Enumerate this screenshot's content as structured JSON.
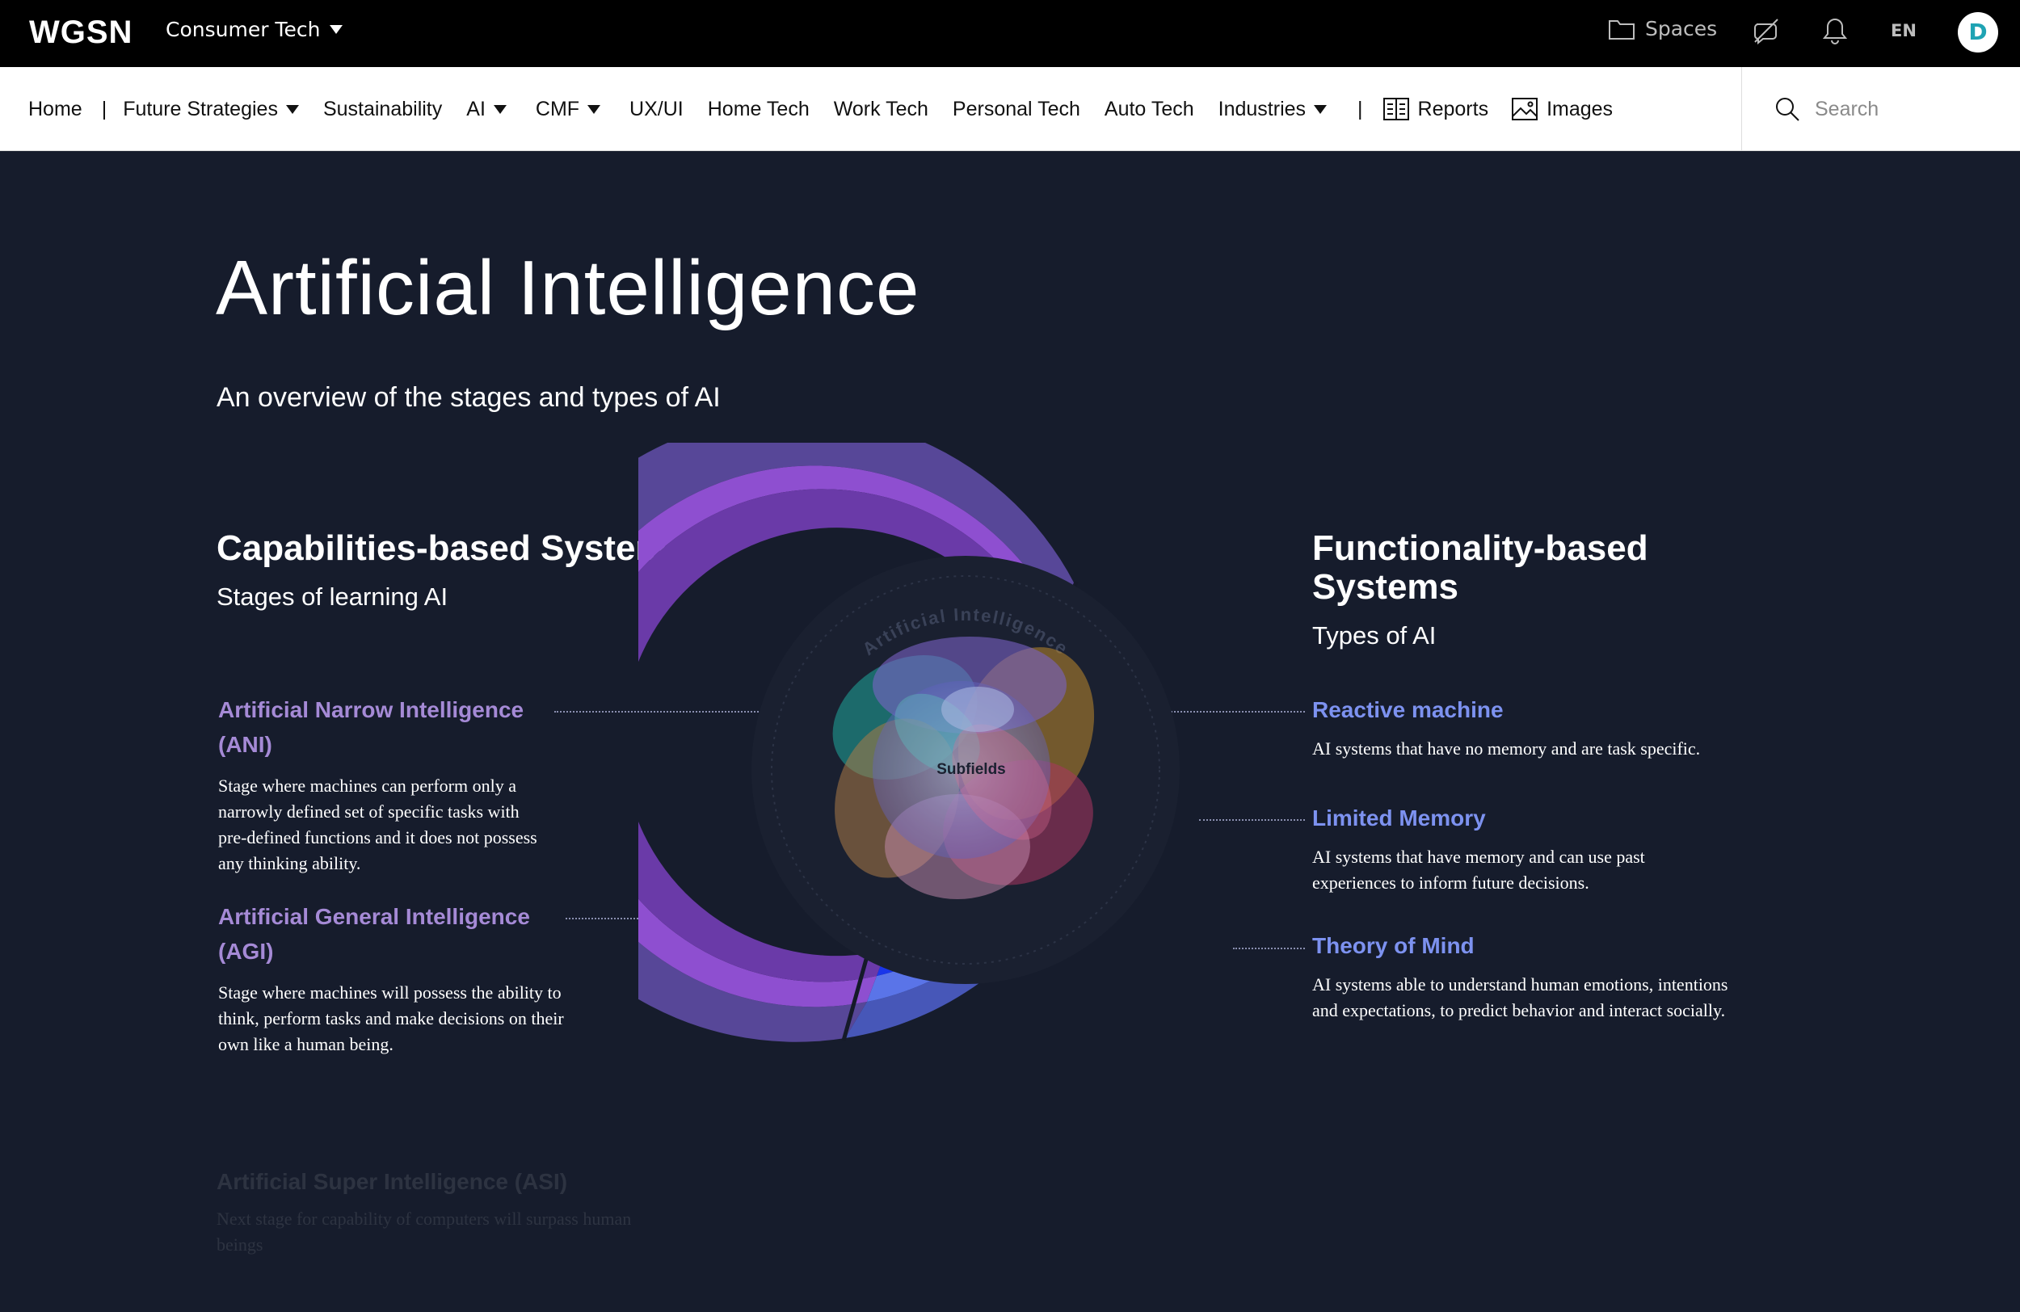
{
  "topbar": {
    "logo": "WGSN",
    "brand": "Consumer Tech",
    "spaces_label": "Spaces",
    "language": "EN",
    "avatar_initial": "D"
  },
  "nav": {
    "items": [
      {
        "label": "Home",
        "dropdown": false
      },
      {
        "label": "Future Strategies",
        "dropdown": true
      },
      {
        "label": "Sustainability",
        "dropdown": false
      },
      {
        "label": "AI",
        "dropdown": true
      },
      {
        "label": "CMF",
        "dropdown": true
      },
      {
        "label": "UX/UI",
        "dropdown": false
      },
      {
        "label": "Home Tech",
        "dropdown": false
      },
      {
        "label": "Work Tech",
        "dropdown": false
      },
      {
        "label": "Personal Tech",
        "dropdown": false
      },
      {
        "label": "Auto Tech",
        "dropdown": false
      },
      {
        "label": "Industries",
        "dropdown": true
      }
    ],
    "reports_label": "Reports",
    "images_label": "Images",
    "search_placeholder": "Search"
  },
  "page": {
    "title": "Artificial Intelligence",
    "subtitle": "An overview of the stages and types of AI"
  },
  "capabilities": {
    "heading": "Capabilities-based Systems",
    "subheading": "Stages of learning AI",
    "stages": [
      {
        "title_line1": "Artificial Narrow Intelligence",
        "title_line2": "(ANI)",
        "desc_lines": [
          "Stage where machines can perform only a",
          "narrowly defined set of specific tasks with",
          "pre-defined functions and it does not possess",
          "any thinking ability."
        ]
      },
      {
        "title_line1": "Artificial General Intelligence",
        "title_line2": "(AGI)",
        "desc_lines": [
          "Stage where machines will possess the ability to",
          "think, perform tasks and make decisions on their",
          "own like a human being."
        ]
      }
    ],
    "faded_stage": {
      "title": "Artificial Super Intelligence (ASI)",
      "desc": "Next stage for capability of computers will surpass human beings"
    }
  },
  "functionality": {
    "heading_line1": "Functionality-based",
    "heading_line2": "Systems",
    "subheading": "Types of AI",
    "types": [
      {
        "title": "Reactive machine",
        "desc_lines": [
          "AI systems that have no memory and are task specific."
        ]
      },
      {
        "title": "Limited Memory",
        "desc_lines": [
          "AI systems that have memory and can use past",
          "experiences to inform future decisions."
        ]
      },
      {
        "title": "Theory of Mind",
        "desc_lines": [
          "AI systems able to understand human emotions, intentions",
          "and expectations, to predict behavior and interact socially."
        ]
      }
    ]
  },
  "diagram": {
    "ring_label": "Artificial Intelligence",
    "center_label": "Subfields",
    "colors": {
      "purple_outer": "#5b4a9e",
      "purple_mid": "#8e4fd0",
      "purple_inner": "#6a3aa8",
      "blue_outer": "#4a5bc0",
      "blue_mid": "#5a74e8",
      "blue_inner": "#1a36ea",
      "dark_center": "#1a2030"
    }
  }
}
